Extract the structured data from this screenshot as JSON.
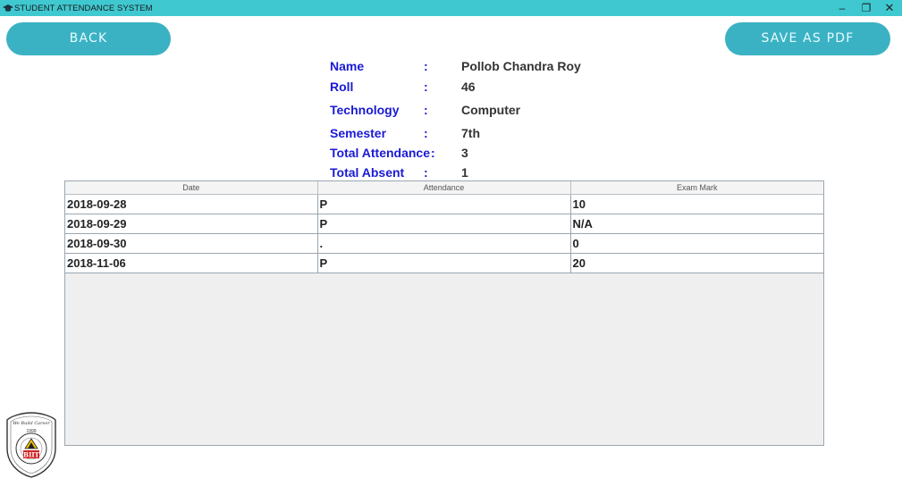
{
  "window": {
    "title": "STUDENT ATTENDANCE SYSTEM",
    "minimize": "–",
    "maximize": "❐",
    "close": "✕"
  },
  "buttons": {
    "back": "BACK",
    "save_pdf": "SAVE AS PDF"
  },
  "student": {
    "fields": [
      {
        "label": "Name",
        "value": "Pollob Chandra Roy"
      },
      {
        "label": "Roll",
        "value": "46"
      },
      {
        "label": "Technology",
        "value": "Computer"
      },
      {
        "label": "Semester",
        "value": "7th"
      },
      {
        "label": "Total Attendance",
        "value": "3"
      },
      {
        "label": "Total Absent",
        "value": "1"
      }
    ],
    "colon": ":"
  },
  "table": {
    "headers": [
      "Date",
      "Attendance",
      "Exam Mark"
    ],
    "rows": [
      [
        "2018-09-28",
        "P",
        "10"
      ],
      [
        "2018-09-29",
        "P",
        "N/A"
      ],
      [
        "2018-09-30",
        ".",
        "0"
      ],
      [
        "2018-11-06",
        "P",
        "20"
      ]
    ]
  },
  "logo": {
    "motto": "We Build Career",
    "year": "1999",
    "abbr": "BIIT"
  },
  "colors": {
    "titlebar": "#3fc8d0",
    "button": "#3bb2c4",
    "label": "#1a1ad6"
  },
  "icons": {
    "app": "graduation-cap-icon"
  }
}
